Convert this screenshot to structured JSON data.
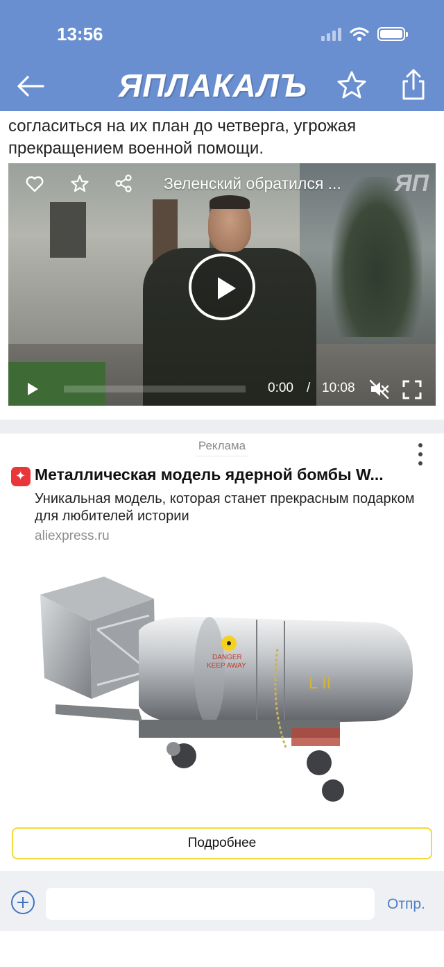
{
  "status_bar": {
    "time": "13:56"
  },
  "header": {
    "logo_text": "ЯПЛАКАЛЪ",
    "back_icon": "arrow-left-icon",
    "favorite_icon": "star-outline-icon",
    "share_icon": "share-upload-icon",
    "background_color": "#6a8fd0"
  },
  "article": {
    "partial_line": "",
    "text": "согласиться на их план до четверга, угрожая прекращением военной помощи."
  },
  "video": {
    "title": "Зеленский обратился ...",
    "watermark": "ЯП",
    "current_time": "0:00",
    "separator": "/",
    "duration": "10:08",
    "progress": 0,
    "muted": true
  },
  "ad": {
    "label": "Реклама",
    "title": "Металлическая модель ядерной бомбы W...",
    "description": "Уникальная модель, которая станет прекрасным подарком для любителей истории",
    "domain": "aliexpress.ru",
    "image_text_danger": "DANGER",
    "image_text_keep_away": "KEEP AWAY",
    "image_text_model": "L II",
    "button_label": "Подробнее",
    "button_border_color": "#f2da3a",
    "brand_color": "#e8363a"
  },
  "composer": {
    "placeholder": "",
    "send_label": "Отпр."
  }
}
